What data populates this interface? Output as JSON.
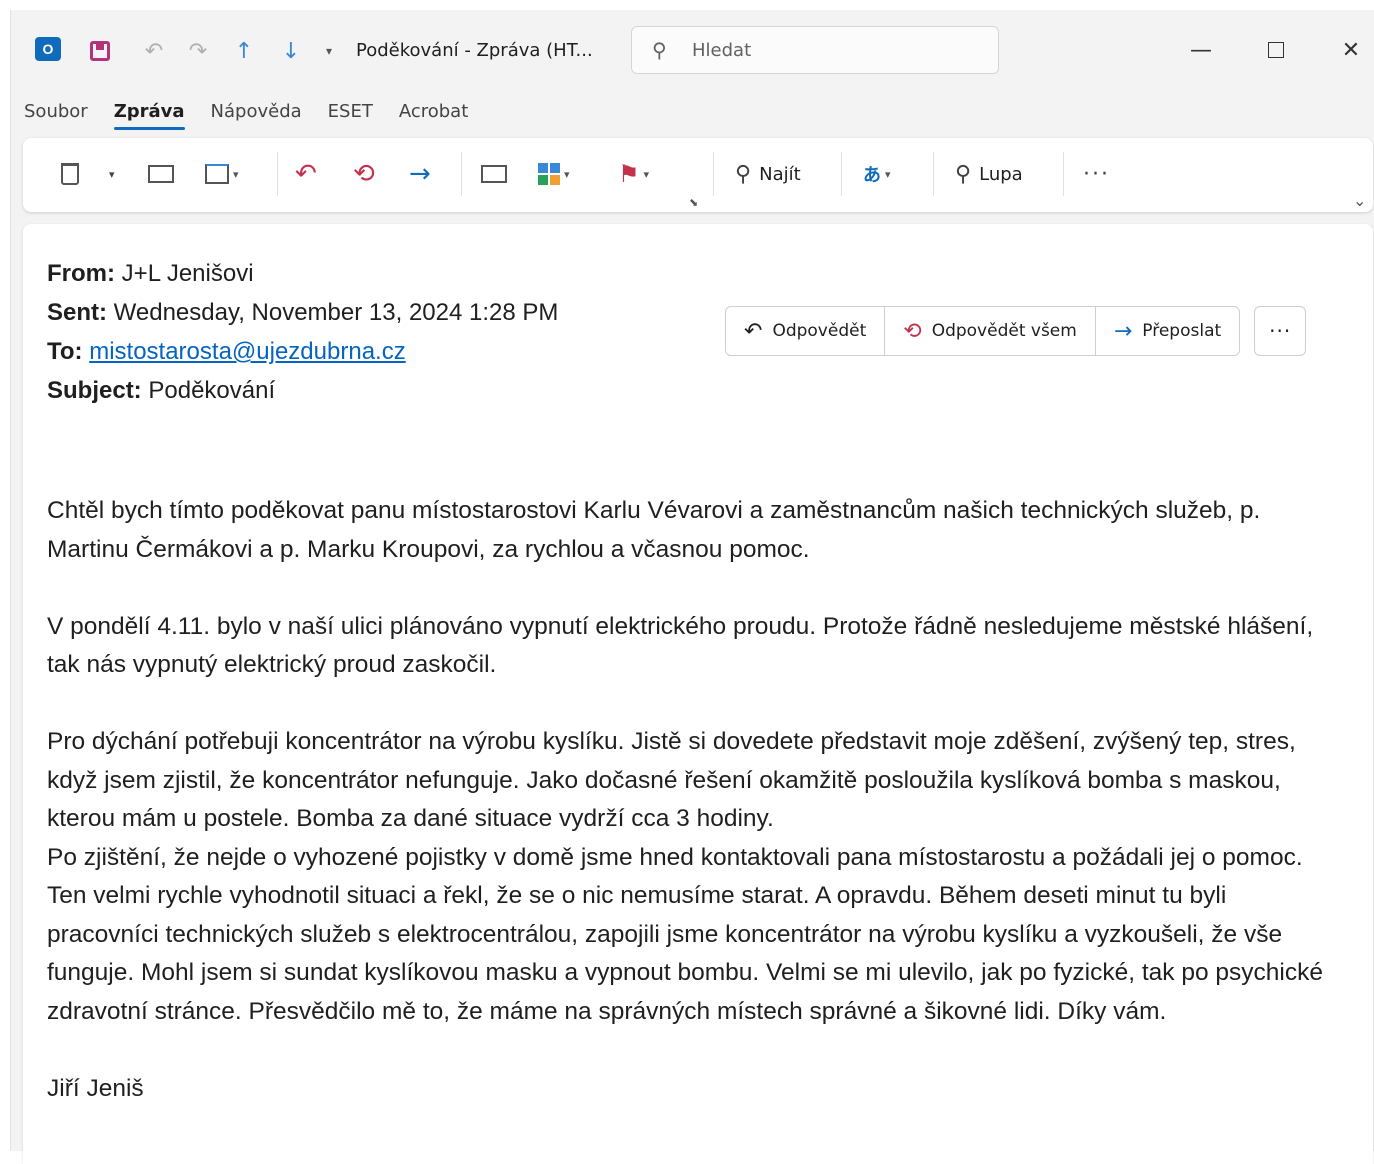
{
  "titlebar": {
    "app_logo": "outlook-logo",
    "window_title": "Poděkování - Zpráva (HT...",
    "search_placeholder": "Hledat"
  },
  "menu": {
    "tabs": [
      "Soubor",
      "Zpráva",
      "Nápověda",
      "ESET",
      "Acrobat"
    ],
    "active": "Zpráva"
  },
  "ribbon": {
    "find_label": "Najít",
    "zoom_label": "Lupa"
  },
  "header": {
    "from_label": "From:",
    "from_value": "J+L Jenišovi",
    "sent_label": "Sent:",
    "sent_value": "Wednesday, November 13, 2024 1:28 PM",
    "to_label": "To:",
    "to_value": "mistostarosta@ujezdubrna.cz",
    "subject_label": "Subject:",
    "subject_value": "Poděkování"
  },
  "actions": {
    "reply": "Odpovědět",
    "reply_all": "Odpovědět všem",
    "forward": "Přeposlat"
  },
  "body": {
    "p1": "Chtěl bych tímto poděkovat panu místostarostovi Karlu Vévarovi a zaměstnancům našich technických služeb, p. Martinu Čermákovi a p. Marku Kroupovi, za rychlou a včasnou pomoc.",
    "p2": "V pondělí 4.11. bylo v naší ulici plánováno vypnutí elektrického proudu. Protože řádně nesledujeme městské hlášení, tak nás vypnutý elektrický proud zaskočil.",
    "p3": "Pro dýchání potřebuji koncentrátor na výrobu kyslíku. Jistě si dovedete představit moje zděšení, zvýšený tep, stres, když jsem zjistil, že koncentrátor nefunguje. Jako dočasné řešení okamžitě posloužila kyslíková bomba s maskou, kterou mám u postele. Bomba za dané situace vydrží cca 3 hodiny.",
    "p4": "Po zjištění, že nejde o vyhozené pojistky v domě jsme hned kontaktovali pana místostarostu a požádali jej o pomoc. Ten velmi rychle vyhodnotil situaci a řekl, že se o nic nemusíme starat. A opravdu. Během deseti minut tu byli pracovníci technických služeb s elektrocentrálou, zapojili jsme koncentrátor na výrobu kyslíku a vyzkoušeli, že vše funguje. Mohl jsem si sundat kyslíkovou masku a vypnout bombu. Velmi se mi ulevilo, jak po fyzické, tak po psychické zdravotní stránce. Přesvědčilo mě to, že máme na správných místech správné a šikovné lidi. Díky vám.",
    "signature": "Jiří Jeniš"
  },
  "colors": {
    "accent": "#0f6cbd",
    "link": "#0563c1",
    "reply_icon": "#c4314b",
    "window_bg": "#f3f3f3"
  }
}
